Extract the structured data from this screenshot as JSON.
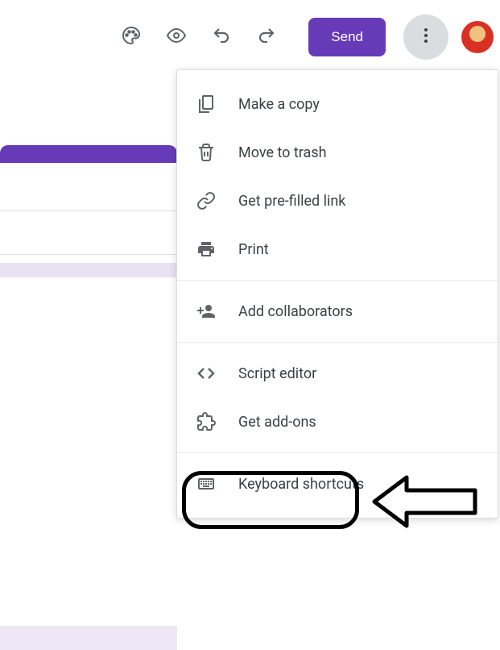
{
  "toolbar": {
    "send_label": "Send"
  },
  "menu": {
    "make_copy": "Make a copy",
    "move_trash": "Move to trash",
    "prefilled": "Get pre-filled link",
    "print": "Print",
    "collaborators": "Add collaborators",
    "script_editor": "Script editor",
    "addons": "Get add-ons",
    "shortcuts": "Keyboard shortcuts"
  }
}
